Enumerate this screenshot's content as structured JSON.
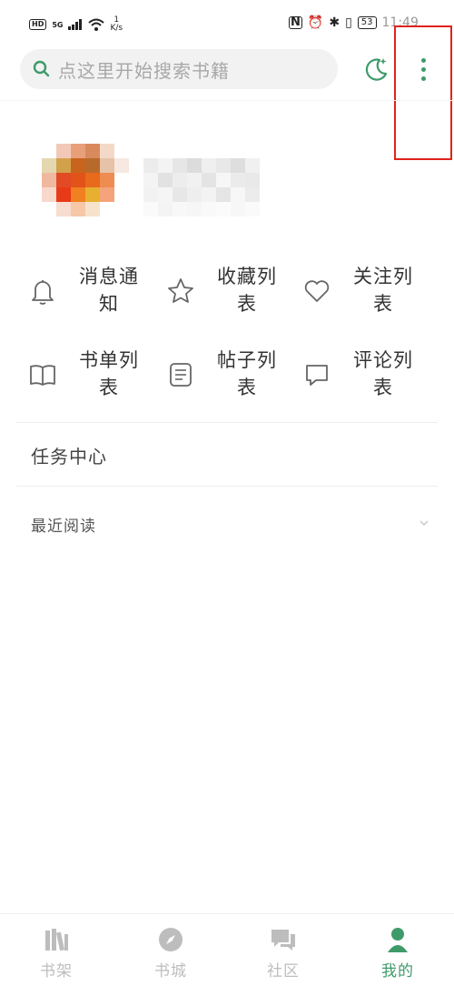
{
  "status_bar": {
    "left_badge": "HD",
    "network": "5G",
    "speed_value": "1",
    "speed_unit": "K/s",
    "battery": "53",
    "time": "11:49"
  },
  "search": {
    "placeholder": "点这里开始搜索书籍"
  },
  "colors": {
    "accent": "#3f9a6a",
    "highlight_box": "#e0231c",
    "text": "#333333",
    "muted": "#a8a8a8"
  },
  "menu": {
    "items": [
      {
        "label": "消息通知",
        "icon": "bell-icon"
      },
      {
        "label": "收藏列表",
        "icon": "star-icon"
      },
      {
        "label": "关注列表",
        "icon": "heart-icon"
      },
      {
        "label": "书单列表",
        "icon": "book-icon"
      },
      {
        "label": "帖子列表",
        "icon": "post-icon"
      },
      {
        "label": "评论列表",
        "icon": "comment-icon"
      }
    ]
  },
  "task_center": {
    "label": "任务中心"
  },
  "recent_reading": {
    "label": "最近阅读"
  },
  "bottom_nav": {
    "items": [
      {
        "label": "书架",
        "icon": "bookshelf-icon",
        "active": false
      },
      {
        "label": "书城",
        "icon": "compass-icon",
        "active": false
      },
      {
        "label": "社区",
        "icon": "chat-icon",
        "active": false
      },
      {
        "label": "我的",
        "icon": "user-icon",
        "active": true
      }
    ]
  }
}
